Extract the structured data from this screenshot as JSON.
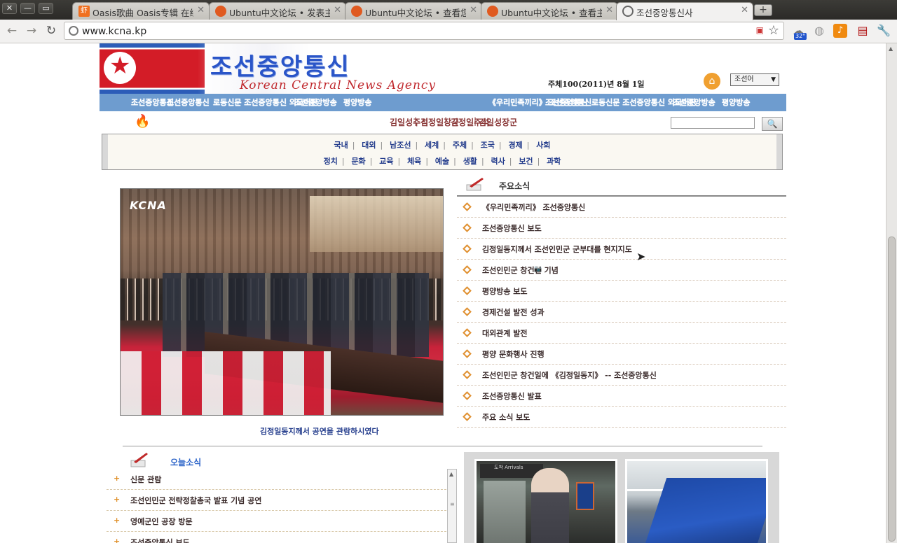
{
  "browser": {
    "tabs": [
      {
        "title": "Oasis歌曲 Oasis专辑 在线试",
        "active": false,
        "favicon": "xiami-icon"
      },
      {
        "title": "Ubuntu中文论坛 • 发表主题",
        "active": false,
        "favicon": "ubuntu-icon"
      },
      {
        "title": "Ubuntu中文论坛 • 查看您的",
        "active": false,
        "favicon": "ubuntu-icon"
      },
      {
        "title": "Ubuntu中文论坛 • 查看主题",
        "active": false,
        "favicon": "ubuntu-icon"
      },
      {
        "title": "조선중앙통신사",
        "active": true,
        "favicon": "globe-icon"
      }
    ],
    "url": "www.kcna.kp",
    "weather_badge": "32°"
  },
  "header": {
    "agency_korean": "조선중앙통신",
    "agency_english": "Korean Central News Agency",
    "date_text": "주체100(2011)년 8월 1일",
    "language_selected": "조선어"
  },
  "menubar": {
    "left": [
      "조선중앙통신",
      "조선중앙통신",
      "로동신문 조선중앙통신 외국어판",
      "조선중앙방송",
      "평양방송"
    ],
    "right": [
      "《우리민족끼리》 조선중앙통신",
      "조선중앙통신",
      "로동신문 조선중앙통신 외국어판",
      "조선중앙방송",
      "평양방송"
    ]
  },
  "secondary": {
    "links": [
      "김일성주석",
      "김정일장군",
      "김정일주석",
      "김일성장군"
    ],
    "search_placeholder": "",
    "search_button": "🔍"
  },
  "categories": {
    "row1": [
      "국내",
      "대외",
      "남조선",
      "세계",
      "주체",
      "조국",
      "경제",
      "사회"
    ],
    "row2": [
      "정치",
      "문화",
      "교육",
      "체육",
      "예술",
      "생활",
      "력사",
      "보건",
      "과학"
    ]
  },
  "main_photo": {
    "watermark": "KCNA",
    "caption": "김정일동지께서 공연을 관람하시였다"
  },
  "news": {
    "title": "주요소식",
    "items": [
      "《우리민족끼리》 조선중앙통신",
      "조선중앙통신 보도",
      "김정일동지께서 조선인민군 군부대를 현지지도",
      "조선인민군 창건일 기념",
      "평양방송 보도",
      "경제건설 발전 성과",
      "대외관계 발전",
      "평양 문화행사 진행",
      "조선인민군 창건일에 《김정일동지》 -- 조선중앙통신",
      "조선중앙통신 발표",
      "주요 소식 보도"
    ]
  },
  "bottom": {
    "title": "오늘소식",
    "items": [
      "신문 관람",
      "조선인민군 전략정찰총국 발표 기념 공연",
      "영예군인 공장 방문",
      "조선중앙통신 보도"
    ],
    "photo_sign": "도착 Arrivals"
  }
}
